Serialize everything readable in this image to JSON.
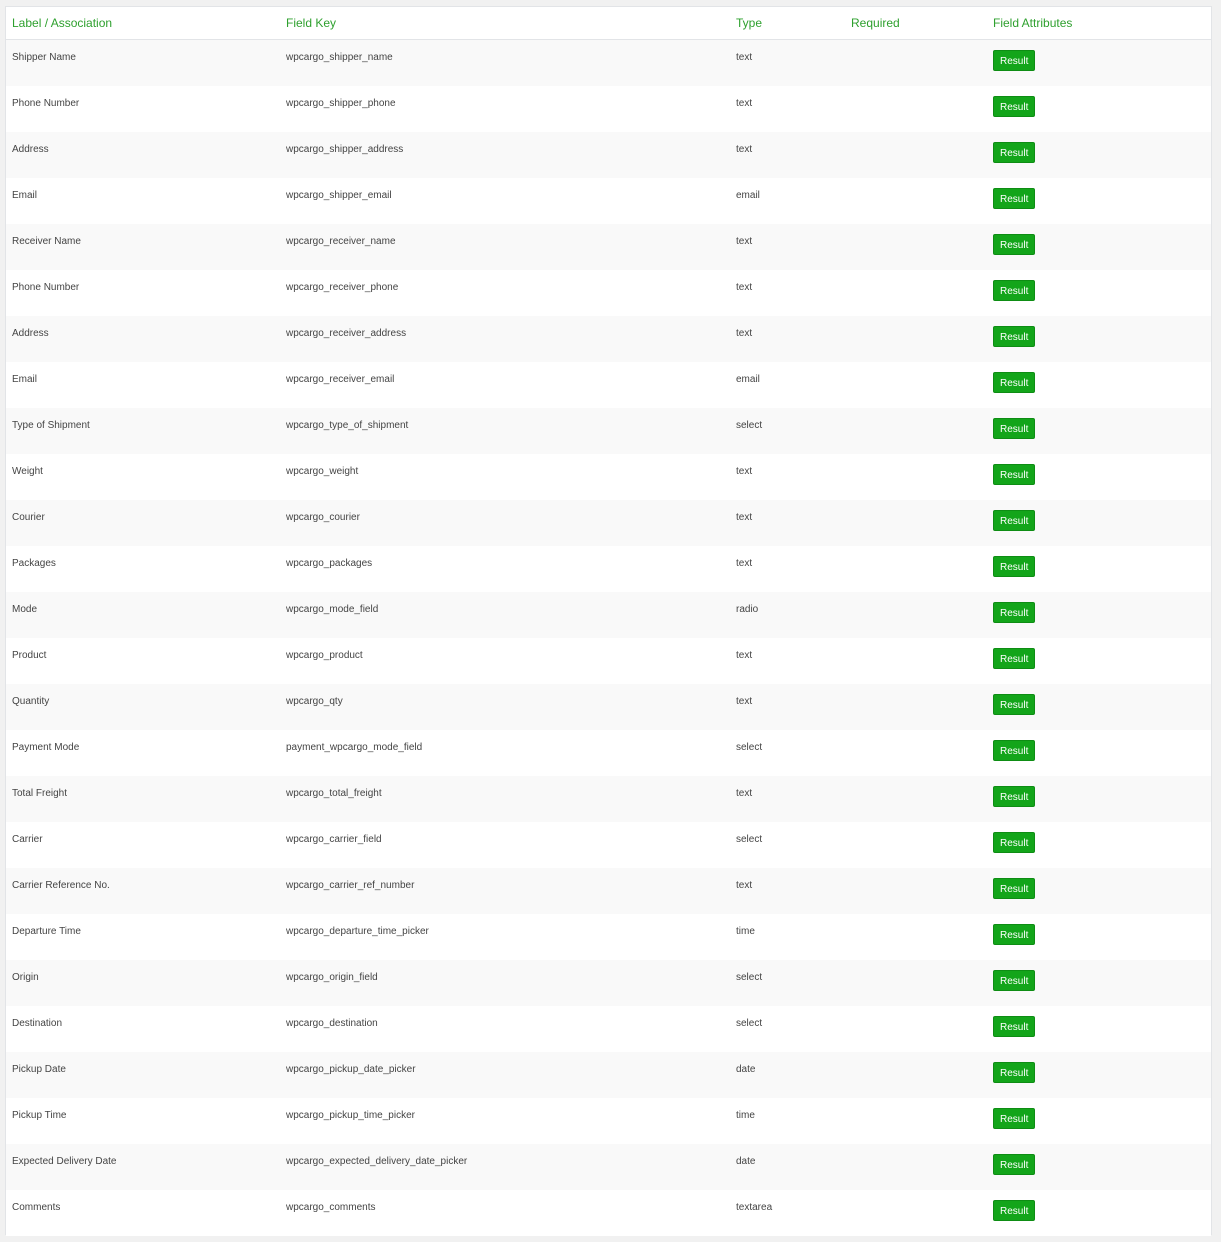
{
  "colors": {
    "header_text": "#2ea02e",
    "button_bg": "#13a51a",
    "button_text": "#ffffff"
  },
  "columns": [
    {
      "key": "label",
      "text": "Label / Association"
    },
    {
      "key": "field_key",
      "text": "Field Key"
    },
    {
      "key": "type",
      "text": "Type"
    },
    {
      "key": "required",
      "text": "Required"
    },
    {
      "key": "attributes",
      "text": "Field Attributes"
    }
  ],
  "button_label": "Result",
  "rows": [
    {
      "label": "Shipper Name",
      "field_key": "wpcargo_shipper_name",
      "type": "text",
      "required": ""
    },
    {
      "label": "Phone Number",
      "field_key": "wpcargo_shipper_phone",
      "type": "text",
      "required": ""
    },
    {
      "label": "Address",
      "field_key": "wpcargo_shipper_address",
      "type": "text",
      "required": ""
    },
    {
      "label": "Email",
      "field_key": "wpcargo_shipper_email",
      "type": "email",
      "required": ""
    },
    {
      "label": "Receiver Name",
      "field_key": "wpcargo_receiver_name",
      "type": "text",
      "required": ""
    },
    {
      "label": "Phone Number",
      "field_key": "wpcargo_receiver_phone",
      "type": "text",
      "required": ""
    },
    {
      "label": "Address",
      "field_key": "wpcargo_receiver_address",
      "type": "text",
      "required": ""
    },
    {
      "label": "Email",
      "field_key": "wpcargo_receiver_email",
      "type": "email",
      "required": ""
    },
    {
      "label": "Type of Shipment",
      "field_key": "wpcargo_type_of_shipment",
      "type": "select",
      "required": ""
    },
    {
      "label": "Weight",
      "field_key": "wpcargo_weight",
      "type": "text",
      "required": ""
    },
    {
      "label": "Courier",
      "field_key": "wpcargo_courier",
      "type": "text",
      "required": ""
    },
    {
      "label": "Packages",
      "field_key": "wpcargo_packages",
      "type": "text",
      "required": ""
    },
    {
      "label": "Mode",
      "field_key": "wpcargo_mode_field",
      "type": "radio",
      "required": ""
    },
    {
      "label": "Product",
      "field_key": "wpcargo_product",
      "type": "text",
      "required": ""
    },
    {
      "label": "Quantity",
      "field_key": "wpcargo_qty",
      "type": "text",
      "required": ""
    },
    {
      "label": "Payment Mode",
      "field_key": "payment_wpcargo_mode_field",
      "type": "select",
      "required": ""
    },
    {
      "label": "Total Freight",
      "field_key": "wpcargo_total_freight",
      "type": "text",
      "required": ""
    },
    {
      "label": "Carrier",
      "field_key": "wpcargo_carrier_field",
      "type": "select",
      "required": ""
    },
    {
      "label": "Carrier Reference No.",
      "field_key": "wpcargo_carrier_ref_number",
      "type": "text",
      "required": ""
    },
    {
      "label": "Departure Time",
      "field_key": "wpcargo_departure_time_picker",
      "type": "time",
      "required": ""
    },
    {
      "label": "Origin",
      "field_key": "wpcargo_origin_field",
      "type": "select",
      "required": ""
    },
    {
      "label": "Destination",
      "field_key": "wpcargo_destination",
      "type": "select",
      "required": ""
    },
    {
      "label": "Pickup Date",
      "field_key": "wpcargo_pickup_date_picker",
      "type": "date",
      "required": ""
    },
    {
      "label": "Pickup Time",
      "field_key": "wpcargo_pickup_time_picker",
      "type": "time",
      "required": ""
    },
    {
      "label": "Expected Delivery Date",
      "field_key": "wpcargo_expected_delivery_date_picker",
      "type": "date",
      "required": ""
    },
    {
      "label": "Comments",
      "field_key": "wpcargo_comments",
      "type": "textarea",
      "required": ""
    }
  ]
}
